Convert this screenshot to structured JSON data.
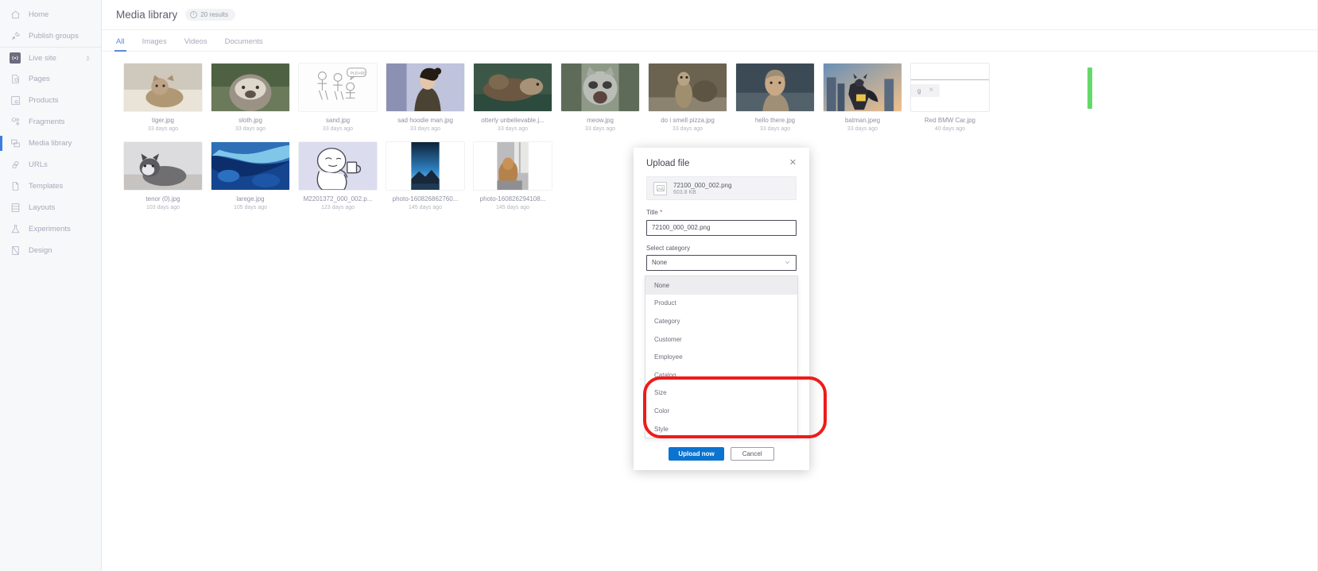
{
  "sidebar": {
    "items": [
      {
        "label": "Home",
        "icon": "home-icon"
      },
      {
        "label": "Publish groups",
        "icon": "publish-groups-icon"
      },
      {
        "label": "Live site",
        "icon": "live-site-icon"
      },
      {
        "label": "Pages",
        "icon": "pages-icon"
      },
      {
        "label": "Products",
        "icon": "products-icon"
      },
      {
        "label": "Fragments",
        "icon": "fragments-icon"
      },
      {
        "label": "Media library",
        "icon": "media-library-icon"
      },
      {
        "label": "URLs",
        "icon": "urls-icon"
      },
      {
        "label": "Templates",
        "icon": "templates-icon"
      },
      {
        "label": "Layouts",
        "icon": "layouts-icon"
      },
      {
        "label": "Experiments",
        "icon": "experiments-icon"
      },
      {
        "label": "Design",
        "icon": "design-icon"
      }
    ]
  },
  "header": {
    "title": "Media library",
    "results_badge": "20 results",
    "info_glyph": "i"
  },
  "tabs": [
    {
      "label": "All",
      "active": true
    },
    {
      "label": "Images",
      "active": false
    },
    {
      "label": "Videos",
      "active": false
    },
    {
      "label": "Documents",
      "active": false
    }
  ],
  "grid": {
    "row1": [
      {
        "name": "tiger.jpg",
        "date": "33 days ago",
        "thumb": "cat"
      },
      {
        "name": "sloth.jpg",
        "date": "33 days ago",
        "thumb": "sloth"
      },
      {
        "name": "sand.jpg",
        "date": "33 days ago",
        "thumb": "sketch"
      },
      {
        "name": "sad hoodie man.jpg",
        "date": "33 days ago",
        "thumb": "hoodie"
      },
      {
        "name": "otterly unbelievable.j...",
        "date": "33 days ago",
        "thumb": "otter"
      },
      {
        "name": "meow.jpg",
        "date": "33 days ago",
        "thumb": "raccoon"
      },
      {
        "name": "do i smell pizza.jpg",
        "date": "33 days ago",
        "thumb": "meerkat"
      },
      {
        "name": "hello there.jpg",
        "date": "33 days ago",
        "thumb": "obiwan"
      },
      {
        "name": "batman.jpeg",
        "date": "33 days ago",
        "thumb": "batman"
      },
      {
        "name": "Red BMW Car.jpg",
        "date": "40 days ago",
        "thumb": "upload"
      }
    ],
    "row2": [
      {
        "name": "tenor (0).jpg",
        "date": "103 days ago",
        "thumb": "husky"
      },
      {
        "name": "larege.jpg",
        "date": "105 days ago",
        "thumb": "blue"
      },
      {
        "name": "M2201372_000_002.p...",
        "date": "123 days ago",
        "thumb": "doodle"
      },
      {
        "name": "photo-160826862760...",
        "date": "145 days ago",
        "thumb": "mountain"
      },
      {
        "name": "photo-160826294108...",
        "date": "145 days ago",
        "thumb": "dog"
      }
    ]
  },
  "upload_progress": {
    "file_label_partial": "g",
    "cancel_glyph": "×",
    "bar_color": "#64d96a"
  },
  "modal": {
    "title": "Upload file",
    "close_glyph": "✕",
    "file": {
      "name": "72100_000_002.png",
      "size": "603.8 KB"
    },
    "title_field": {
      "label": "Title",
      "required_mark": "*",
      "value": "72100_000_002.png"
    },
    "category_field": {
      "label": "Select category",
      "selected": "None",
      "options": [
        "None",
        "Product",
        "Category",
        "Customer",
        "Employee",
        "Catalog",
        "Size",
        "Color",
        "Style"
      ]
    },
    "buttons": {
      "primary": "Upload now",
      "secondary": "Cancel"
    }
  },
  "colors": {
    "accent": "#0b73d0",
    "tab_active": "#5c8ad6",
    "annotation": "#ef1b1b",
    "progress_green": "#64d96a"
  }
}
